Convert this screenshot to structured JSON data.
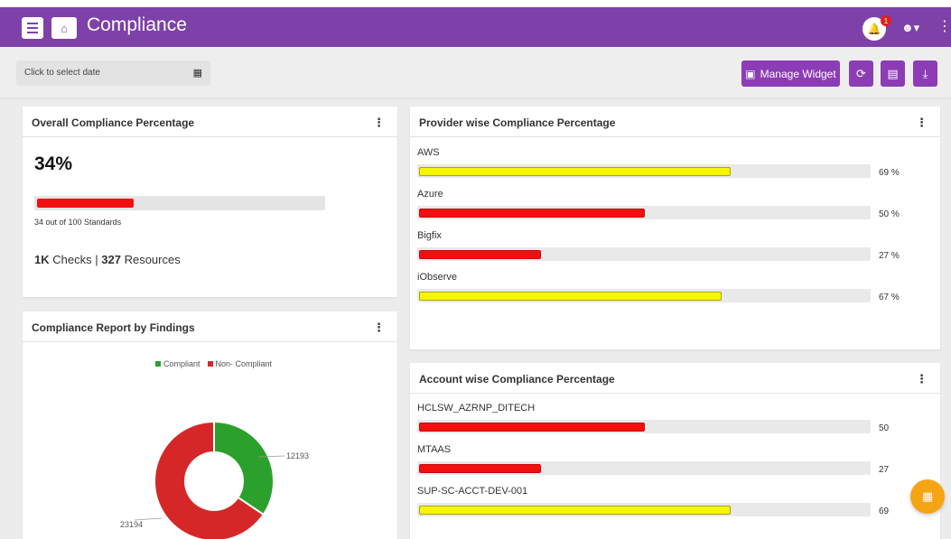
{
  "header": {
    "title": "Compliance",
    "notification_count": "1",
    "icons": [
      "menu-icon",
      "home-icon",
      "bell-icon",
      "user-icon",
      "more-vert-icon"
    ]
  },
  "toolbar": {
    "date_placeholder": "Click to select date",
    "manage_widget_label": "Manage Widget",
    "icons": [
      "calendar-icon",
      "dashboard-icon",
      "refresh-icon",
      "save-icon",
      "download-icon"
    ]
  },
  "overall": {
    "title": "Overall Compliance Percentage",
    "percentage": "34%",
    "fraction": 0.34,
    "standards_text": "34 out of 100  Standards",
    "checks_value": "1K",
    "checks_label": "Checks",
    "separator": "|",
    "resources_value": "327",
    "resources_label": "Resources"
  },
  "findings": {
    "title": "Compliance Report by Findings",
    "legend": [
      {
        "label": "Compliant",
        "color": "#2ca02c"
      },
      {
        "label": "Non- Compliant",
        "color": "#d62728"
      }
    ],
    "compliant_value": "12193",
    "non_compliant_value": "23194",
    "compliant_count": 12193,
    "non_compliant_count": 23194
  },
  "provider": {
    "title": "Provider wise Compliance Percentage",
    "rows": [
      {
        "label": "AWS",
        "value": "69 %",
        "fraction": 0.69,
        "color": "#f6f600"
      },
      {
        "label": "Azure",
        "value": "50 %",
        "fraction": 0.5,
        "color": "#f20f0f"
      },
      {
        "label": "Bigfix",
        "value": "27 %",
        "fraction": 0.27,
        "color": "#f20f0f"
      },
      {
        "label": "iObserve",
        "value": "67 %",
        "fraction": 0.67,
        "color": "#f6f600"
      }
    ]
  },
  "account": {
    "title": "Account wise Compliance Percentage",
    "rows": [
      {
        "label": "HCLSW_AZRNP_DITECH",
        "value": "50",
        "fraction": 0.5,
        "color": "#f20f0f"
      },
      {
        "label": "MTAAS",
        "value": "27",
        "fraction": 0.27,
        "color": "#f20f0f"
      },
      {
        "label": "SUP-SC-ACCT-DEV-001",
        "value": "69",
        "fraction": 0.69,
        "color": "#f6f600"
      }
    ]
  },
  "fab": {
    "icon": "qr-code-icon"
  }
}
